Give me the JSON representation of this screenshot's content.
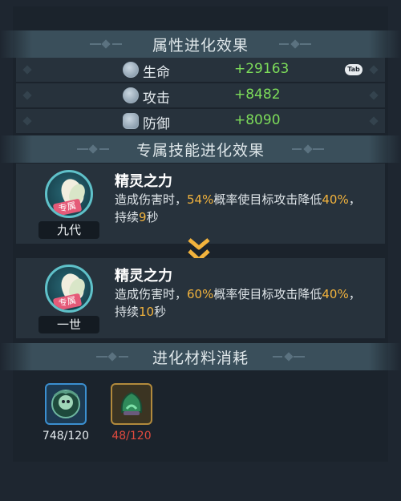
{
  "attr_section": {
    "title": "属性进化效果"
  },
  "stats": [
    {
      "label": "生命",
      "value": "+29163",
      "icon": "heart-shield-icon"
    },
    {
      "label": "攻击",
      "value": "+8482",
      "icon": "attack-shield-icon"
    },
    {
      "label": "防御",
      "value": "+8090",
      "icon": "defense-shield-icon"
    }
  ],
  "tab_hint": "Tab",
  "skill_section": {
    "title": "专属技能进化效果"
  },
  "skills": [
    {
      "tier": "九代",
      "exclusive_tag": "专属",
      "name": "精灵之力",
      "desc_parts": [
        "造成伤害时，",
        "54%",
        "概率使目标攻击降低",
        "40%",
        "，持续",
        "9",
        "秒"
      ]
    },
    {
      "tier": "一世",
      "exclusive_tag": "专属",
      "name": "精灵之力",
      "desc_parts": [
        "造成伤害时，",
        "60%",
        "概率使目标攻击降低",
        "40%",
        "，持续",
        "10",
        "秒"
      ]
    }
  ],
  "material_section": {
    "title": "进化材料消耗"
  },
  "materials": [
    {
      "name": "monster-soul-icon",
      "count": "748/120",
      "count_color": "#e6ecf0",
      "border": "#3b8fd0"
    },
    {
      "name": "jade-helmet-icon",
      "count": "48/120",
      "count_color": "#e04a3e",
      "border": "#b28a3c"
    }
  ],
  "colors": {
    "highlight": "#f2b33d",
    "stat_value": "#7ddc5a",
    "insufficient": "#e04a3e"
  }
}
